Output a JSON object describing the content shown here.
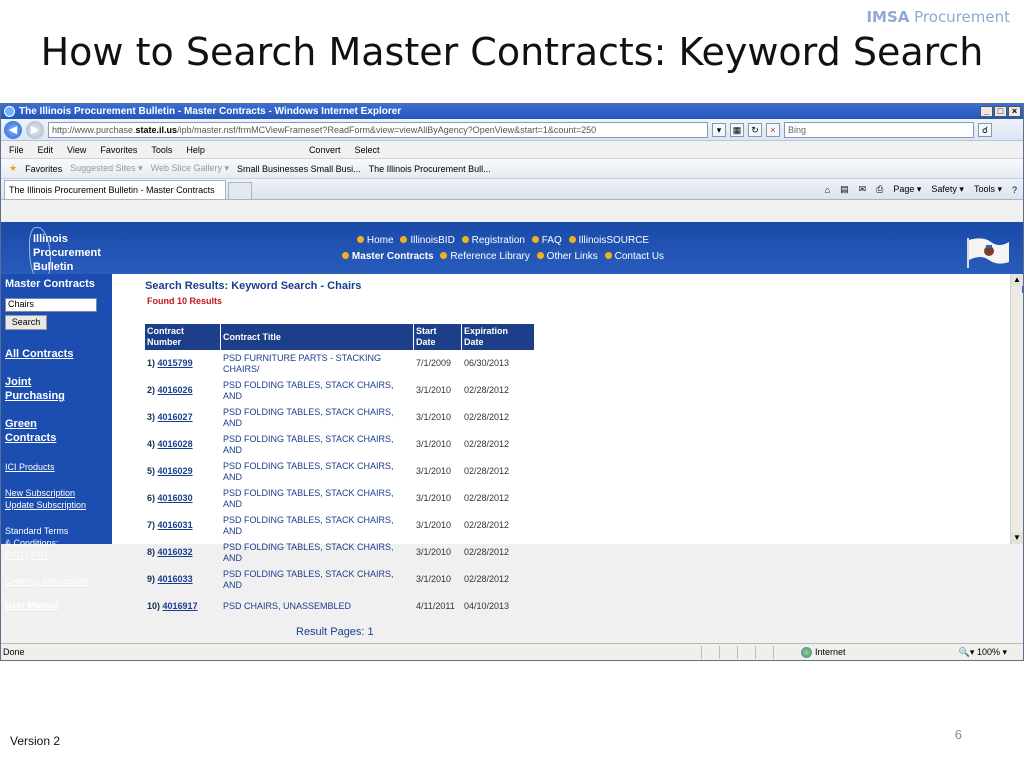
{
  "slide": {
    "brand_bold": "IMSA",
    "brand_rest": " Procurement",
    "title": "How to Search Master Contracts: Keyword Search",
    "version": "Version 2",
    "page_number": "6"
  },
  "browser": {
    "window_title": "The Illinois Procurement Bulletin - Master Contracts - Windows Internet Explorer",
    "url_prefix": "http://www.purchase.",
    "url_domain": "state.il.us",
    "url_suffix": "/ipb/master.nsf/frmMCViewFrameset?ReadForm&view=viewAllByAgency?OpenView&start=1&count=250",
    "search_placeholder": "Bing",
    "menu": [
      "File",
      "Edit",
      "View",
      "Favorites",
      "Tools",
      "Help"
    ],
    "menu_extra": [
      "Convert",
      "Select"
    ],
    "favorites_label": "Favorites",
    "favorites_items": [
      "Suggested Sites ▾",
      "Web Slice Gallery ▾",
      "Small Businesses  Small Busi...",
      "The Illinois Procurement Bull..."
    ],
    "tab_title": "The Illinois Procurement Bulletin - Master Contracts",
    "commands": [
      "Page ▾",
      "Safety ▾",
      "Tools ▾"
    ],
    "status": "Done",
    "zone": "Internet",
    "zoom": "100%"
  },
  "site": {
    "logo_lines": [
      "Illinois",
      "Procurement",
      "Bulletin"
    ],
    "nav_row1": [
      "Home",
      "IllinoisBID",
      "Registration",
      "FAQ",
      "IllinoisSOURCE"
    ],
    "nav_row2": [
      "Master Contracts",
      "Reference Library",
      "Other Links",
      "Contact Us"
    ]
  },
  "sidebar": {
    "heading": "Master Contracts",
    "search_value": "Chairs",
    "search_button": "Search",
    "all_contracts": "All Contracts",
    "joint_1": "Joint",
    "joint_2": "Purchasing",
    "green_1": "Green",
    "green_2": "Contracts",
    "ici": "ICI Products",
    "new_sub": "New Subscription",
    "update_sub": "Update Subscription",
    "terms_1": "Standard Terms",
    "terms_2": "& Conditions:",
    "psd": "PSD",
    "sep": " \\ ",
    "prt": "PRT",
    "ordering": "Ordering Instructions",
    "manual": "User Manual"
  },
  "results": {
    "heading": "Search Results: Keyword Search - Chairs",
    "found": "Found 10 Results",
    "columns": {
      "num_1": "Contract",
      "num_2": "Number",
      "title": "Contract Title",
      "start_1": "Start",
      "start_2": "Date",
      "exp_1": "Expiration",
      "exp_2": "Date"
    },
    "rows": [
      {
        "idx": "1)",
        "number": "4015799",
        "title": "PSD FURNITURE PARTS - STACKING CHAIRS/",
        "start": "7/1/2009",
        "exp": "06/30/2013"
      },
      {
        "idx": "2)",
        "number": "4016026",
        "title": "PSD FOLDING TABLES, STACK CHAIRS, AND",
        "start": "3/1/2010",
        "exp": "02/28/2012"
      },
      {
        "idx": "3)",
        "number": "4016027",
        "title": "PSD FOLDING TABLES, STACK CHAIRS, AND",
        "start": "3/1/2010",
        "exp": "02/28/2012"
      },
      {
        "idx": "4)",
        "number": "4016028",
        "title": "PSD FOLDING TABLES, STACK CHAIRS, AND",
        "start": "3/1/2010",
        "exp": "02/28/2012"
      },
      {
        "idx": "5)",
        "number": "4016029",
        "title": "PSD FOLDING TABLES, STACK CHAIRS, AND",
        "start": "3/1/2010",
        "exp": "02/28/2012"
      },
      {
        "idx": "6)",
        "number": "4016030",
        "title": "PSD FOLDING TABLES, STACK CHAIRS, AND",
        "start": "3/1/2010",
        "exp": "02/28/2012"
      },
      {
        "idx": "7)",
        "number": "4016031",
        "title": "PSD FOLDING TABLES, STACK CHAIRS, AND",
        "start": "3/1/2010",
        "exp": "02/28/2012"
      },
      {
        "idx": "8)",
        "number": "4016032",
        "title": "PSD FOLDING TABLES, STACK CHAIRS, AND",
        "start": "3/1/2010",
        "exp": "02/28/2012"
      },
      {
        "idx": "9)",
        "number": "4016033",
        "title": "PSD FOLDING TABLES, STACK CHAIRS, AND",
        "start": "3/1/2010",
        "exp": "02/28/2012"
      },
      {
        "idx": "10)",
        "number": "4016917",
        "title": "PSD CHAIRS, UNASSEMBLED",
        "start": "4/11/2011",
        "exp": "04/10/2013"
      }
    ],
    "result_pages": "Result Pages: 1"
  }
}
